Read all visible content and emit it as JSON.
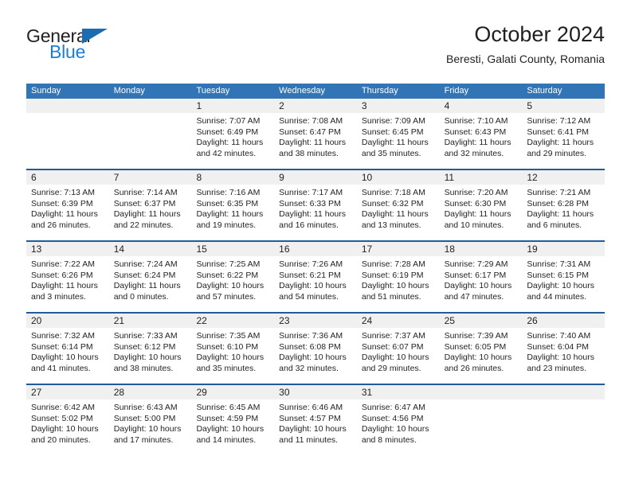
{
  "brand": {
    "name_top": "General",
    "name_bottom": "Blue",
    "accent_color": "#1b6cb0",
    "blue_text_color": "#1b7ed6"
  },
  "header": {
    "title": "October 2024",
    "subtitle": "Beresti, Galati County, Romania"
  },
  "theme": {
    "header_band": "#3275b7",
    "week_divider": "#1f5c99",
    "daynum_band": "#f0f0f0",
    "text": "#231f20"
  },
  "weekday_headers": [
    "Sunday",
    "Monday",
    "Tuesday",
    "Wednesday",
    "Thursday",
    "Friday",
    "Saturday"
  ],
  "weeks": [
    [
      {
        "day": "",
        "sunrise": "",
        "sunset": "",
        "daylight_line1": "",
        "daylight_line2": "",
        "empty": true
      },
      {
        "day": "",
        "sunrise": "",
        "sunset": "",
        "daylight_line1": "",
        "daylight_line2": "",
        "empty": true
      },
      {
        "day": "1",
        "sunrise": "Sunrise: 7:07 AM",
        "sunset": "Sunset: 6:49 PM",
        "daylight_line1": "Daylight: 11 hours",
        "daylight_line2": "and 42 minutes.",
        "empty": false
      },
      {
        "day": "2",
        "sunrise": "Sunrise: 7:08 AM",
        "sunset": "Sunset: 6:47 PM",
        "daylight_line1": "Daylight: 11 hours",
        "daylight_line2": "and 38 minutes.",
        "empty": false
      },
      {
        "day": "3",
        "sunrise": "Sunrise: 7:09 AM",
        "sunset": "Sunset: 6:45 PM",
        "daylight_line1": "Daylight: 11 hours",
        "daylight_line2": "and 35 minutes.",
        "empty": false
      },
      {
        "day": "4",
        "sunrise": "Sunrise: 7:10 AM",
        "sunset": "Sunset: 6:43 PM",
        "daylight_line1": "Daylight: 11 hours",
        "daylight_line2": "and 32 minutes.",
        "empty": false
      },
      {
        "day": "5",
        "sunrise": "Sunrise: 7:12 AM",
        "sunset": "Sunset: 6:41 PM",
        "daylight_line1": "Daylight: 11 hours",
        "daylight_line2": "and 29 minutes.",
        "empty": false
      }
    ],
    [
      {
        "day": "6",
        "sunrise": "Sunrise: 7:13 AM",
        "sunset": "Sunset: 6:39 PM",
        "daylight_line1": "Daylight: 11 hours",
        "daylight_line2": "and 26 minutes.",
        "empty": false
      },
      {
        "day": "7",
        "sunrise": "Sunrise: 7:14 AM",
        "sunset": "Sunset: 6:37 PM",
        "daylight_line1": "Daylight: 11 hours",
        "daylight_line2": "and 22 minutes.",
        "empty": false
      },
      {
        "day": "8",
        "sunrise": "Sunrise: 7:16 AM",
        "sunset": "Sunset: 6:35 PM",
        "daylight_line1": "Daylight: 11 hours",
        "daylight_line2": "and 19 minutes.",
        "empty": false
      },
      {
        "day": "9",
        "sunrise": "Sunrise: 7:17 AM",
        "sunset": "Sunset: 6:33 PM",
        "daylight_line1": "Daylight: 11 hours",
        "daylight_line2": "and 16 minutes.",
        "empty": false
      },
      {
        "day": "10",
        "sunrise": "Sunrise: 7:18 AM",
        "sunset": "Sunset: 6:32 PM",
        "daylight_line1": "Daylight: 11 hours",
        "daylight_line2": "and 13 minutes.",
        "empty": false
      },
      {
        "day": "11",
        "sunrise": "Sunrise: 7:20 AM",
        "sunset": "Sunset: 6:30 PM",
        "daylight_line1": "Daylight: 11 hours",
        "daylight_line2": "and 10 minutes.",
        "empty": false
      },
      {
        "day": "12",
        "sunrise": "Sunrise: 7:21 AM",
        "sunset": "Sunset: 6:28 PM",
        "daylight_line1": "Daylight: 11 hours",
        "daylight_line2": "and 6 minutes.",
        "empty": false
      }
    ],
    [
      {
        "day": "13",
        "sunrise": "Sunrise: 7:22 AM",
        "sunset": "Sunset: 6:26 PM",
        "daylight_line1": "Daylight: 11 hours",
        "daylight_line2": "and 3 minutes.",
        "empty": false
      },
      {
        "day": "14",
        "sunrise": "Sunrise: 7:24 AM",
        "sunset": "Sunset: 6:24 PM",
        "daylight_line1": "Daylight: 11 hours",
        "daylight_line2": "and 0 minutes.",
        "empty": false
      },
      {
        "day": "15",
        "sunrise": "Sunrise: 7:25 AM",
        "sunset": "Sunset: 6:22 PM",
        "daylight_line1": "Daylight: 10 hours",
        "daylight_line2": "and 57 minutes.",
        "empty": false
      },
      {
        "day": "16",
        "sunrise": "Sunrise: 7:26 AM",
        "sunset": "Sunset: 6:21 PM",
        "daylight_line1": "Daylight: 10 hours",
        "daylight_line2": "and 54 minutes.",
        "empty": false
      },
      {
        "day": "17",
        "sunrise": "Sunrise: 7:28 AM",
        "sunset": "Sunset: 6:19 PM",
        "daylight_line1": "Daylight: 10 hours",
        "daylight_line2": "and 51 minutes.",
        "empty": false
      },
      {
        "day": "18",
        "sunrise": "Sunrise: 7:29 AM",
        "sunset": "Sunset: 6:17 PM",
        "daylight_line1": "Daylight: 10 hours",
        "daylight_line2": "and 47 minutes.",
        "empty": false
      },
      {
        "day": "19",
        "sunrise": "Sunrise: 7:31 AM",
        "sunset": "Sunset: 6:15 PM",
        "daylight_line1": "Daylight: 10 hours",
        "daylight_line2": "and 44 minutes.",
        "empty": false
      }
    ],
    [
      {
        "day": "20",
        "sunrise": "Sunrise: 7:32 AM",
        "sunset": "Sunset: 6:14 PM",
        "daylight_line1": "Daylight: 10 hours",
        "daylight_line2": "and 41 minutes.",
        "empty": false
      },
      {
        "day": "21",
        "sunrise": "Sunrise: 7:33 AM",
        "sunset": "Sunset: 6:12 PM",
        "daylight_line1": "Daylight: 10 hours",
        "daylight_line2": "and 38 minutes.",
        "empty": false
      },
      {
        "day": "22",
        "sunrise": "Sunrise: 7:35 AM",
        "sunset": "Sunset: 6:10 PM",
        "daylight_line1": "Daylight: 10 hours",
        "daylight_line2": "and 35 minutes.",
        "empty": false
      },
      {
        "day": "23",
        "sunrise": "Sunrise: 7:36 AM",
        "sunset": "Sunset: 6:08 PM",
        "daylight_line1": "Daylight: 10 hours",
        "daylight_line2": "and 32 minutes.",
        "empty": false
      },
      {
        "day": "24",
        "sunrise": "Sunrise: 7:37 AM",
        "sunset": "Sunset: 6:07 PM",
        "daylight_line1": "Daylight: 10 hours",
        "daylight_line2": "and 29 minutes.",
        "empty": false
      },
      {
        "day": "25",
        "sunrise": "Sunrise: 7:39 AM",
        "sunset": "Sunset: 6:05 PM",
        "daylight_line1": "Daylight: 10 hours",
        "daylight_line2": "and 26 minutes.",
        "empty": false
      },
      {
        "day": "26",
        "sunrise": "Sunrise: 7:40 AM",
        "sunset": "Sunset: 6:04 PM",
        "daylight_line1": "Daylight: 10 hours",
        "daylight_line2": "and 23 minutes.",
        "empty": false
      }
    ],
    [
      {
        "day": "27",
        "sunrise": "Sunrise: 6:42 AM",
        "sunset": "Sunset: 5:02 PM",
        "daylight_line1": "Daylight: 10 hours",
        "daylight_line2": "and 20 minutes.",
        "empty": false
      },
      {
        "day": "28",
        "sunrise": "Sunrise: 6:43 AM",
        "sunset": "Sunset: 5:00 PM",
        "daylight_line1": "Daylight: 10 hours",
        "daylight_line2": "and 17 minutes.",
        "empty": false
      },
      {
        "day": "29",
        "sunrise": "Sunrise: 6:45 AM",
        "sunset": "Sunset: 4:59 PM",
        "daylight_line1": "Daylight: 10 hours",
        "daylight_line2": "and 14 minutes.",
        "empty": false
      },
      {
        "day": "30",
        "sunrise": "Sunrise: 6:46 AM",
        "sunset": "Sunset: 4:57 PM",
        "daylight_line1": "Daylight: 10 hours",
        "daylight_line2": "and 11 minutes.",
        "empty": false
      },
      {
        "day": "31",
        "sunrise": "Sunrise: 6:47 AM",
        "sunset": "Sunset: 4:56 PM",
        "daylight_line1": "Daylight: 10 hours",
        "daylight_line2": "and 8 minutes.",
        "empty": false
      },
      {
        "day": "",
        "sunrise": "",
        "sunset": "",
        "daylight_line1": "",
        "daylight_line2": "",
        "empty": true
      },
      {
        "day": "",
        "sunrise": "",
        "sunset": "",
        "daylight_line1": "",
        "daylight_line2": "",
        "empty": true
      }
    ]
  ]
}
